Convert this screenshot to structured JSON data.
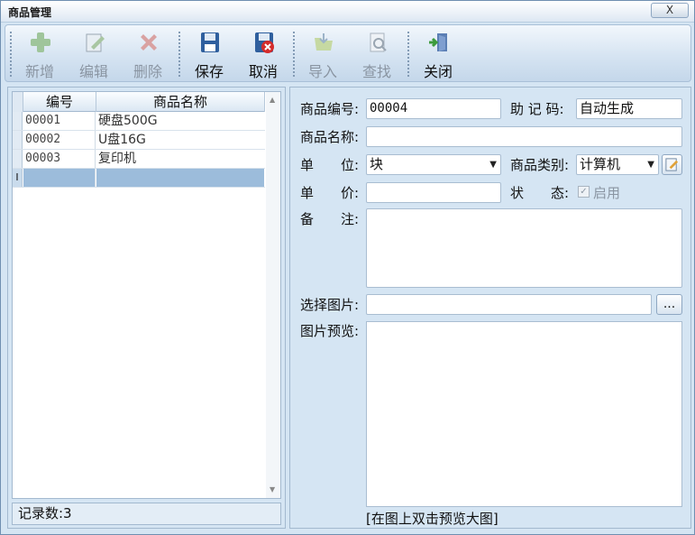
{
  "window": {
    "title": "商品管理",
    "close_label": "X"
  },
  "toolbar": {
    "buttons": [
      {
        "label": "新增",
        "icon": "plus-icon",
        "enabled": false
      },
      {
        "label": "编辑",
        "icon": "edit-icon",
        "enabled": false
      },
      {
        "label": "删除",
        "icon": "delete-icon",
        "enabled": false
      },
      {
        "label": "保存",
        "icon": "save-icon",
        "enabled": true
      },
      {
        "label": "取消",
        "icon": "cancel-icon",
        "enabled": true
      },
      {
        "label": "导入",
        "icon": "import-icon",
        "enabled": false
      },
      {
        "label": "查找",
        "icon": "search-icon",
        "enabled": false
      },
      {
        "label": "关闭",
        "icon": "exit-icon",
        "enabled": true
      }
    ]
  },
  "grid": {
    "columns": [
      "编号",
      "商品名称"
    ],
    "rows": [
      {
        "id": "00001",
        "name": "硬盘500G"
      },
      {
        "id": "00002",
        "name": "U盘16G"
      },
      {
        "id": "00003",
        "name": "复印机"
      }
    ],
    "new_row_marker": "I"
  },
  "status": {
    "record_count": "记录数:3"
  },
  "form": {
    "code_label": "商品编号:",
    "code_value": "00004",
    "mnemonic_label": "助 记 码:",
    "mnemonic_value": "自动生成",
    "name_label": "商品名称:",
    "name_value": "",
    "unit_label": "单　　位:",
    "unit_value": "块",
    "category_label": "商品类别:",
    "category_value": "计算机",
    "price_label": "单　　价:",
    "price_value": "",
    "state_label": "状　　态:",
    "state_checkbox_label": "启用",
    "state_checked": true,
    "remark_label": "备　　注:",
    "remark_value": "",
    "image_label": "选择图片:",
    "image_value": "",
    "browse_label": "...",
    "preview_label": "图片预览:",
    "preview_hint": "[在图上双击预览大图]"
  },
  "colors": {
    "accent": "#9cbcdb",
    "window_bg": "#d5e5f3"
  }
}
